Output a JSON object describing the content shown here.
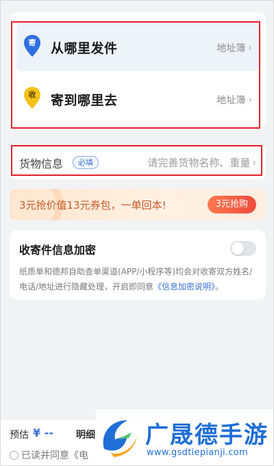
{
  "address": {
    "sender": {
      "pin_label": "寄",
      "title": "从哪里发件",
      "book_label": "地址簿"
    },
    "receiver": {
      "pin_label": "收",
      "title": "寄到哪里去",
      "book_label": "地址簿"
    }
  },
  "goods": {
    "label": "货物信息",
    "badge": "必填",
    "placeholder": "请完善货物名称、重量"
  },
  "promo": {
    "text": "3元抢价值13元券包，一单回本!",
    "button_label": "3元抢购"
  },
  "encrypt": {
    "title": "收寄件信息加密",
    "enabled": false,
    "desc_before": "纸质单和德邦自助查单渠道(APP/小程序等)均会对收寄双方姓名/电话/地址进行隐藏处理，开启即同意",
    "desc_link": "《信息加密说明》",
    "desc_after": "。"
  },
  "bottom": {
    "estimate_label": "预估",
    "estimate_value": "¥ --",
    "detail_label": "明细",
    "agree_text": "已读并同意《电"
  },
  "watermark": {
    "title": "广晟德手游",
    "url": "www.gsdtiepianji.com"
  },
  "colors": {
    "accent_blue": "#3b6fd6",
    "highlight_red": "#e0202a",
    "promo_orange": "#ee4a3c"
  }
}
